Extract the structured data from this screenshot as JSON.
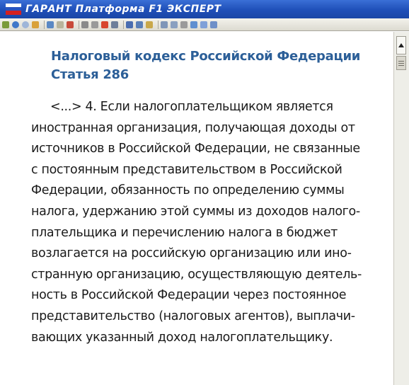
{
  "window": {
    "title": "ГАРАНТ Платформа F1 ЭКСПЕРТ"
  },
  "document": {
    "heading_line1": "Налоговый кодекс Российской Федерации",
    "heading_line2": "Статья 286",
    "paragraph_lines": [
      "<...> 4. Если налогоплательщиком является",
      "иностранная организация, получающая доходы от",
      "источников в Российской Федерации, не связанные",
      "с постоянным представительством в Российской",
      "Федерации, обязанность по определению суммы",
      "налога, удержанию этой суммы из доходов налого-",
      "плательщика и перечислению налога в бюджет",
      "возлагается на российскую организацию или ино-",
      "странную организацию, осуществляющую деятель-",
      "ность в Российской Федерации через постоянное",
      "представительство (налоговых агентов), выплачи-",
      "вающих указанный доход налогоплательщику."
    ]
  },
  "colors": {
    "titlebar": "#1f4fb8",
    "heading": "#2c5f98",
    "text": "#1a1a1a"
  }
}
